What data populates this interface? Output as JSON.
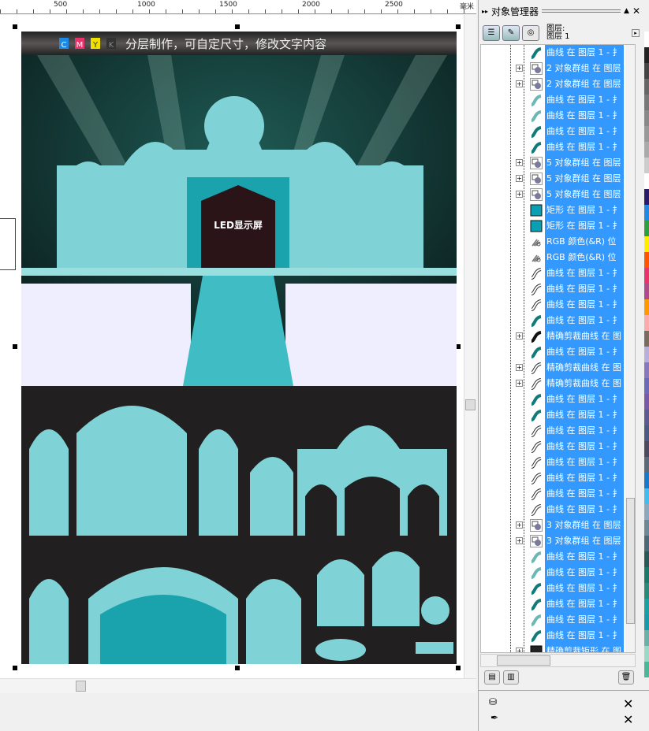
{
  "ruler": {
    "ticks": [
      "500",
      "1000",
      "1500",
      "2000",
      "2500"
    ],
    "unit": "毫米"
  },
  "artwork": {
    "banner_text": "分层制作，可自定尺寸，修改文字内容",
    "cmyk": [
      "C",
      "M",
      "Y",
      "K"
    ],
    "led_label": "LED显示屏",
    "colors": {
      "background": "#211f1f",
      "teal": "#7fd3d6",
      "dark_teal": "#1aa3ad",
      "banner": "#3a3636"
    }
  },
  "panel": {
    "title": "对象管理器",
    "layer_header": "图层:",
    "layer_name": "图层 1",
    "highlight": "#3399ff",
    "rows": [
      {
        "label": "曲线 在 图层 1 - 扌",
        "icon": "curve-teal",
        "expand": false
      },
      {
        "label": "2 对象群组 在 图层",
        "icon": "group",
        "expand": true
      },
      {
        "label": "2 对象群组 在 图层",
        "icon": "group",
        "expand": true
      },
      {
        "label": "曲线 在 图层 1 - 扌",
        "icon": "curve-light",
        "expand": false
      },
      {
        "label": "曲线 在 图层 1 - 扌",
        "icon": "curve-light",
        "expand": false
      },
      {
        "label": "曲线 在 图层 1 - 扌",
        "icon": "curve-teal",
        "expand": false
      },
      {
        "label": "曲线 在 图层 1 - 扌",
        "icon": "curve-teal",
        "expand": false
      },
      {
        "label": "5 对象群组 在 图层",
        "icon": "group",
        "expand": true
      },
      {
        "label": "5 对象群组 在 图层",
        "icon": "group",
        "expand": true
      },
      {
        "label": "5 对象群组 在 图层",
        "icon": "group",
        "expand": true
      },
      {
        "label": "矩形 在 图层 1 - 扌",
        "icon": "rectangle",
        "expand": false
      },
      {
        "label": "矩形 在 图层 1 - 扌",
        "icon": "rectangle",
        "expand": false
      },
      {
        "label": "RGB 颜色(&R) 位",
        "icon": "rgb-bitmap",
        "expand": false
      },
      {
        "label": "RGB 颜色(&R) 位",
        "icon": "rgb-bitmap",
        "expand": false
      },
      {
        "label": "曲线 在 图层 1 - 扌",
        "icon": "curve-white",
        "expand": false
      },
      {
        "label": "曲线 在 图层 1 - 扌",
        "icon": "curve-white",
        "expand": false
      },
      {
        "label": "曲线 在 图层 1 - 扌",
        "icon": "curve-white",
        "expand": false
      },
      {
        "label": "曲线 在 图层 1 - 扌",
        "icon": "curve-teal",
        "expand": false
      },
      {
        "label": "精确剪裁曲线 在 图",
        "icon": "curve-black",
        "expand": true
      },
      {
        "label": "曲线 在 图层 1 - 扌",
        "icon": "curve-teal",
        "expand": false
      },
      {
        "label": "精确剪裁曲线 在 图",
        "icon": "curve-white",
        "expand": true
      },
      {
        "label": "精确剪裁曲线 在 图",
        "icon": "curve-white",
        "expand": true
      },
      {
        "label": "曲线 在 图层 1 - 扌",
        "icon": "curve-teal",
        "expand": false
      },
      {
        "label": "曲线 在 图层 1 - 扌",
        "icon": "curve-teal",
        "expand": false
      },
      {
        "label": "曲线 在 图层 1 - 扌",
        "icon": "curve-white",
        "expand": false
      },
      {
        "label": "曲线 在 图层 1 - 扌",
        "icon": "curve-white",
        "expand": false
      },
      {
        "label": "曲线 在 图层 1 - 扌",
        "icon": "curve-white",
        "expand": false
      },
      {
        "label": "曲线 在 图层 1 - 扌",
        "icon": "curve-white",
        "expand": false
      },
      {
        "label": "曲线 在 图层 1 - 扌",
        "icon": "curve-white",
        "expand": false
      },
      {
        "label": "曲线 在 图层 1 - 扌",
        "icon": "curve-white",
        "expand": false
      },
      {
        "label": "3 对象群组 在 图层",
        "icon": "group",
        "expand": true
      },
      {
        "label": "3 对象群组 在 图层",
        "icon": "group",
        "expand": true
      },
      {
        "label": "曲线 在 图层 1 - 扌",
        "icon": "curve-light",
        "expand": false
      },
      {
        "label": "曲线 在 图层 1 - 扌",
        "icon": "curve-light",
        "expand": false
      },
      {
        "label": "曲线 在 图层 1 - 扌",
        "icon": "curve-teal",
        "expand": false
      },
      {
        "label": "曲线 在 图层 1 - 扌",
        "icon": "curve-teal",
        "expand": false
      },
      {
        "label": "曲线 在 图层 1 - 扌",
        "icon": "curve-light",
        "expand": false
      },
      {
        "label": "曲线 在 图层 1 - 扌",
        "icon": "curve-teal",
        "expand": false
      },
      {
        "label": "精确剪裁矩形 在 图",
        "icon": "rect-black",
        "expand": true
      }
    ]
  },
  "palette": [
    "#ffffff",
    "#222222",
    "#444444",
    "#666666",
    "#777777",
    "#888888",
    "#999999",
    "#aaaaaa",
    "#cccccc",
    "#ffffff",
    "#2a1a6a",
    "#1e88e5",
    "#2e9e3e",
    "#ffee00",
    "#ff5500",
    "#e8336b",
    "#b04a8a",
    "#ff9900",
    "#ffaaaa",
    "#7a6a60",
    "#b8b0d8",
    "#8878c0",
    "#6a6ab8",
    "#7a5aa8",
    "#5a5a90",
    "#4a5a80",
    "#4a4a60",
    "#5a6a7a",
    "#1a78c8",
    "#44bbee",
    "#8aa8c0",
    "#6a8898",
    "#4a6878",
    "#2a5858",
    "#1a7a6a",
    "#2a8a7a",
    "#1aa0a0",
    "#1a9aa8",
    "#6ab0a8",
    "#9ad8c8",
    "#4ab898"
  ]
}
